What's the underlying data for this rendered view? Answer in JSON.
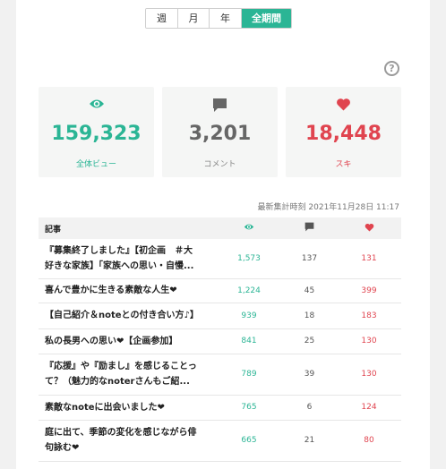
{
  "tabs": [
    {
      "label": "週",
      "active": false
    },
    {
      "label": "月",
      "active": false
    },
    {
      "label": "年",
      "active": false
    },
    {
      "label": "全期間",
      "active": true
    }
  ],
  "help": {
    "icon": "question-icon",
    "symbol": "?"
  },
  "stats": {
    "views": {
      "value": "159,323",
      "label": "全体ビュー",
      "icon": "eye-icon",
      "color": "#2bb595"
    },
    "comments": {
      "value": "3,201",
      "label": "コメント",
      "icon": "comment-icon",
      "color": "#666666"
    },
    "likes": {
      "value": "18,448",
      "label": "スキ",
      "icon": "heart-icon",
      "color": "#e0444f"
    }
  },
  "updated": "最新集計時刻 2021年11月28日 11:17",
  "table": {
    "header": {
      "title": "記事",
      "views_icon": "eye-icon",
      "comments_icon": "comment-icon",
      "likes_icon": "heart-icon"
    },
    "rows": [
      {
        "line1": "『募集終了しました』【初企画　＃大",
        "line2": "好きな家族】「家族への思い・自慢...",
        "views": "1,573",
        "comments": "137",
        "likes": "131"
      },
      {
        "line1": "喜んで豊かに生きる素敵な人生❤",
        "line2": "",
        "views": "1,224",
        "comments": "45",
        "likes": "399"
      },
      {
        "line1": "【自己紹介＆noteとの付き合い方♪】",
        "line2": "",
        "views": "939",
        "comments": "18",
        "likes": "183"
      },
      {
        "line1": "私の長男への思い❤【企画参加】",
        "line2": "",
        "views": "841",
        "comments": "25",
        "likes": "130"
      },
      {
        "line1": "『応援』や『励まし』を感じることっ",
        "line2": "て？（魅力的なnoterさんもご紹...",
        "views": "789",
        "comments": "39",
        "likes": "130"
      },
      {
        "line1": "素敵なnoteに出会いました❤",
        "line2": "",
        "views": "765",
        "comments": "6",
        "likes": "124"
      },
      {
        "line1": "庭に出て、季節の変化を感じながら俳",
        "line2": "句詠む❤",
        "views": "665",
        "comments": "21",
        "likes": "80"
      }
    ]
  }
}
